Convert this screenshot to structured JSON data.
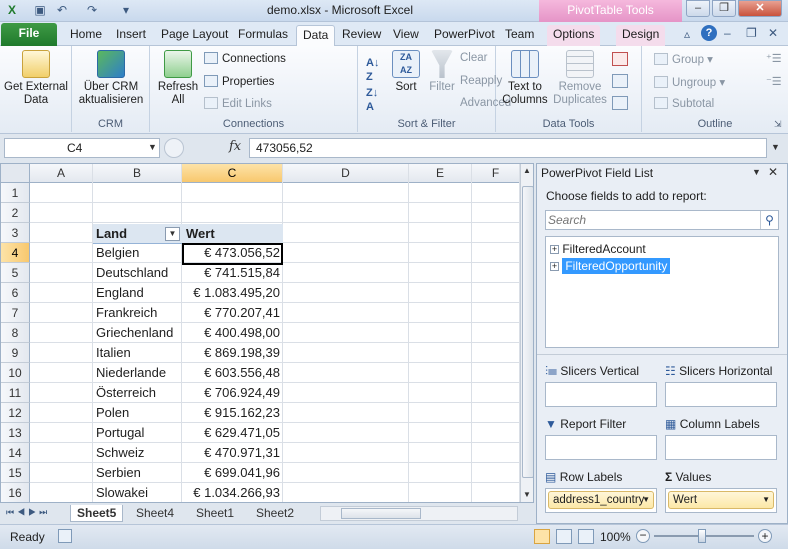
{
  "window": {
    "title": "demo.xlsx  -  Microsoft Excel",
    "context_tab_group": "PivotTable Tools"
  },
  "tabs": {
    "file": "File",
    "items": [
      "Home",
      "Insert",
      "Page Layout",
      "Formulas",
      "Data",
      "Review",
      "View",
      "PowerPivot",
      "Team",
      "Options",
      "Design"
    ],
    "active": "Data"
  },
  "ribbon": {
    "get_external_data": "Get External Data",
    "crm_button": "Über CRM aktualisieren",
    "crm_group": "CRM",
    "refresh_all": "Refresh All",
    "connections": "Connections",
    "properties": "Properties",
    "edit_links": "Edit Links",
    "connections_group": "Connections",
    "sort": "Sort",
    "filter": "Filter",
    "clear": "Clear",
    "reapply": "Reapply",
    "advanced": "Advanced",
    "sort_filter_group": "Sort & Filter",
    "text_to_columns": "Text to Columns",
    "remove_duplicates": "Remove Duplicates",
    "data_tools_group": "Data Tools",
    "group": "Group",
    "ungroup": "Ungroup",
    "subtotal": "Subtotal",
    "outline_group": "Outline"
  },
  "formula_bar": {
    "name_box": "C4",
    "fx": "fx",
    "value": "473056,52"
  },
  "sheet": {
    "columns": [
      "A",
      "B",
      "C",
      "D",
      "E",
      "F"
    ],
    "rows": [
      "1",
      "2",
      "3",
      "4",
      "5",
      "6",
      "7",
      "8",
      "9",
      "10",
      "11",
      "12",
      "13",
      "14",
      "15",
      "16"
    ],
    "header": {
      "land": "Land",
      "wert": "Wert"
    },
    "data": [
      {
        "land": "Belgien",
        "wert": "€ 473.056,52"
      },
      {
        "land": "Deutschland",
        "wert": "€ 741.515,84"
      },
      {
        "land": "England",
        "wert": "€ 1.083.495,20"
      },
      {
        "land": "Frankreich",
        "wert": "€ 770.207,41"
      },
      {
        "land": "Griechenland",
        "wert": "€ 400.498,00"
      },
      {
        "land": "Italien",
        "wert": "€ 869.198,39"
      },
      {
        "land": "Niederlande",
        "wert": "€ 603.556,48"
      },
      {
        "land": "Österreich",
        "wert": "€ 706.924,49"
      },
      {
        "land": "Polen",
        "wert": "€ 915.162,23"
      },
      {
        "land": "Portugal",
        "wert": "€ 629.471,05"
      },
      {
        "land": "Schweiz",
        "wert": "€ 470.971,31"
      },
      {
        "land": "Serbien",
        "wert": "€ 699.041,96"
      },
      {
        "land": "Slowakei",
        "wert": "€ 1.034.266,93"
      }
    ],
    "tabs": [
      "Sheet5",
      "Sheet4",
      "Sheet1",
      "Sheet2"
    ],
    "active_tab": "Sheet5"
  },
  "powerpivot": {
    "title": "PowerPivot Field List",
    "choose_fields": "Choose fields to add to report:",
    "search_placeholder": "Search",
    "fields": [
      "FilteredAccount",
      "FilteredOpportunity"
    ],
    "selected_field": "FilteredOpportunity",
    "slicers_vertical": "Slicers Vertical",
    "slicers_horizontal": "Slicers Horizontal",
    "report_filter": "Report Filter",
    "column_labels": "Column Labels",
    "row_labels": "Row Labels",
    "values": "Values",
    "row_label_item": "address1_country",
    "value_item": "Wert"
  },
  "status": {
    "ready": "Ready",
    "zoom": "100%"
  },
  "colors": {
    "file_tab": "#2a8a36",
    "context_tab": "#e99ccd",
    "selection": "#f8c86e",
    "field_highlight": "#3399ff"
  }
}
